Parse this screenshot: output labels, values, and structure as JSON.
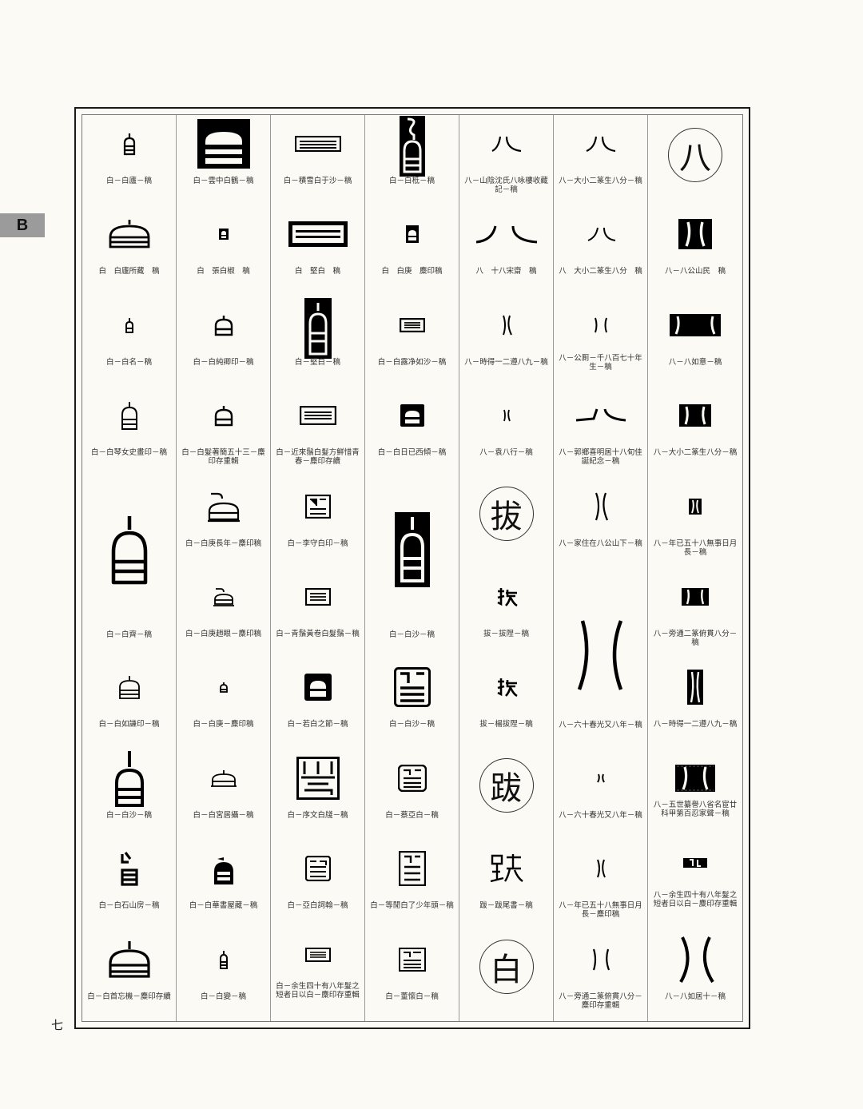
{
  "section_tab": "B",
  "page_number": "七",
  "columns": [
    {
      "items": [
        {
          "icon": "seal-bai-small",
          "caption": "白－白廬－稿"
        },
        {
          "icon": "seal-bai-wide",
          "caption": "白　白廬所藏　稿"
        },
        {
          "icon": "seal-bai-tiny",
          "caption": "白－白名－稿"
        },
        {
          "icon": "seal-bai-outline",
          "caption": "白－白琴女史畫印－稿"
        },
        {
          "icon": "seal-bai-large",
          "caption": "白－白齊－稿"
        },
        {
          "icon": "seal-bai-outline",
          "caption": "白－白如謙印－稿"
        },
        {
          "icon": "seal-bai-tall",
          "caption": "白－白沙－稿"
        },
        {
          "icon": "seal-bai-variant",
          "caption": "白－白石山房－稿"
        },
        {
          "icon": "seal-bai-wide",
          "caption": "白－白首忘機－麋印存續"
        }
      ]
    },
    {
      "items": [
        {
          "icon": "seal-bai-block",
          "caption": "白－雲中白鶴－稿"
        },
        {
          "icon": "seal-bai-dot",
          "caption": "白　張白椒　稿"
        },
        {
          "icon": "seal-bai-small",
          "caption": "白－白純卿印－稿"
        },
        {
          "icon": "seal-bai-small",
          "caption": "白－白髮著簡五十三－麋印存重輯"
        },
        {
          "icon": "seal-bai-open",
          "caption": "白－白庚長年－麋印稿"
        },
        {
          "icon": "seal-bai-open",
          "caption": "白－白庚趙眼－麋印稿"
        },
        {
          "icon": "seal-bai-tiny",
          "caption": "白－白庚－麋印稿"
        },
        {
          "icon": "seal-bai-flat",
          "caption": "白－白宮居攝－稿"
        },
        {
          "icon": "seal-bai-solid",
          "caption": "白－白華書屋藏－稿"
        },
        {
          "icon": "seal-bai-thin",
          "caption": "白－白變－稿"
        }
      ]
    },
    {
      "items": [
        {
          "icon": "seal-bai-bar",
          "caption": "白－積雪白于沙－稿"
        },
        {
          "icon": "seal-bai-barbox",
          "caption": "白　堅白　稿"
        },
        {
          "icon": "seal-bai-blocktall",
          "caption": "白－堅白－稿"
        },
        {
          "icon": "seal-bai-bar",
          "caption": "白－近來鬚白髮方鮮惜青春－麋印存續"
        },
        {
          "icon": "seal-bai-sq",
          "caption": "白－李守白印－稿"
        },
        {
          "icon": "seal-bai-sq",
          "caption": "白－青鬚黃卷白髮鬚－稿"
        },
        {
          "icon": "seal-bai-sqblock",
          "caption": "白－若白之節－稿"
        },
        {
          "icon": "seal-bai-sqbig",
          "caption": "白－序文白牋－稿"
        },
        {
          "icon": "seal-bai-sq",
          "caption": "白－亞白詞翰－稿"
        },
        {
          "icon": "seal-bai-bar",
          "caption": "白－余生四十有八年髮之短者日以白－麋印存重輯"
        }
      ]
    },
    {
      "items": [
        {
          "icon": "seal-bai-blocktall2",
          "caption": "白－白柢－稿"
        },
        {
          "icon": "seal-bai-blocksm",
          "caption": "白　白庚　麋印稿"
        },
        {
          "icon": "seal-bai-bar",
          "caption": "白－白露净如沙－稿"
        },
        {
          "icon": "seal-bai-sqblock",
          "caption": "白－白日已西傾－稿"
        },
        {
          "icon": "seal-bai-blocktall3",
          "caption": "白－白沙－稿"
        },
        {
          "icon": "seal-bai-sqbig",
          "caption": "白－白沙－稿"
        },
        {
          "icon": "seal-bai-sq",
          "caption": "白－蔡亞白－稿"
        },
        {
          "icon": "seal-bai-sq",
          "caption": "白－等閒白了少年頭－稿"
        },
        {
          "icon": "seal-bai-sq",
          "caption": "白－董懷白－稿"
        }
      ]
    },
    {
      "items": [
        {
          "icon": "seal-ba-curve",
          "caption": "八－山陰沈氏八咏樓收藏記－稿"
        },
        {
          "icon": "seal-ba-curve",
          "caption": "八　十八宋齋　稿"
        },
        {
          "icon": "seal-ba-pair",
          "caption": "八－時得一二遵八九－稿"
        },
        {
          "icon": "seal-ba-pair",
          "caption": "八－袁八行－稿"
        },
        {
          "icon": "char-ba",
          "headword": "拔",
          "caption": ""
        },
        {
          "icon": "seal-ba-hand",
          "caption": "拔－拔陧－稿"
        },
        {
          "icon": "seal-ba-hand",
          "caption": "拔－楊拔陧－稿"
        },
        {
          "icon": "char-ba",
          "headword": "跋",
          "caption": ""
        },
        {
          "icon": "seal-ba-foot",
          "caption": "跋－跋尾書－稿"
        },
        {
          "icon": "char-ba",
          "headword": "白",
          "caption": ""
        }
      ]
    },
    {
      "items": [
        {
          "icon": "seal-ba-curve",
          "caption": "八－大小二篆生八分－稿"
        },
        {
          "icon": "seal-ba-curve",
          "caption": "八　大小二篆生八分　稿"
        },
        {
          "icon": "seal-ba-pair",
          "caption": "八－公厠－千八百七十年生－稿"
        },
        {
          "icon": "seal-ba-wide",
          "caption": "八－郭鄉喜明居十八旬佳誕紀念－稿"
        },
        {
          "icon": "seal-ba-pair",
          "caption": "八－家住在八公山下－稿"
        },
        {
          "icon": "seal-ba-large",
          "caption": "八－六十春光又八年－稿"
        },
        {
          "icon": "seal-ba-tiny",
          "caption": "八－六十春光又八年－稿"
        },
        {
          "icon": "seal-ba-pair",
          "caption": "八－年已五十八無事日月長－麋印稿"
        },
        {
          "icon": "seal-ba-pair",
          "caption": "八－旁通二篆俯貫八分－麋印存重輯"
        }
      ]
    },
    {
      "items": [
        {
          "icon": "char-ba",
          "headword": "八",
          "caption": ""
        },
        {
          "icon": "seal-ba-block",
          "caption": "八－八公山民　稿"
        },
        {
          "icon": "seal-ba-block",
          "caption": "八－八如意－稿"
        },
        {
          "icon": "seal-ba-block",
          "caption": "八－大小二篆生八分－稿"
        },
        {
          "icon": "seal-ba-block",
          "caption": "八－年已五十八無事日月長－稿"
        },
        {
          "icon": "seal-ba-block",
          "caption": "八－旁通二篆俯貫八分－稿"
        },
        {
          "icon": "seal-ba-block",
          "caption": "八－時得一二遵八九－稿"
        },
        {
          "icon": "seal-ba-block",
          "caption": "八－五世纂譽八省名宦廿科甲第百忍家聲－稿"
        },
        {
          "icon": "seal-ba-block",
          "caption": "八－余生四十有八年髮之短者日以白－麋印存重輯"
        },
        {
          "icon": "seal-ba-pairlarge",
          "caption": "八－八如居十－稿"
        }
      ]
    }
  ]
}
